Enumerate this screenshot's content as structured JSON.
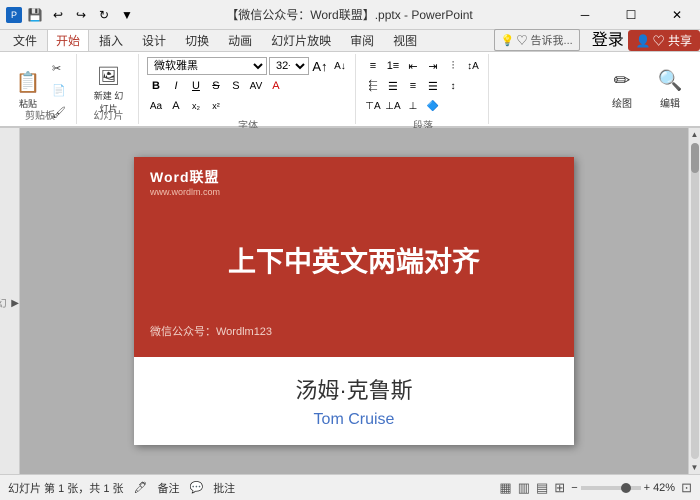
{
  "titlebar": {
    "title": "【微信公众号：Word联盟】.pptx - PowerPoint",
    "save_icon": "💾",
    "undo": "↩",
    "redo": "↪",
    "customize": "▼",
    "window_min": "─",
    "window_restore": "🗗",
    "window_close": "✕"
  },
  "ribbon": {
    "tabs": [
      "文件",
      "开始",
      "插入",
      "设计",
      "切换",
      "动画",
      "幻灯片放映",
      "审阅",
      "视图"
    ],
    "active_tab": "开始",
    "tell_me_label": "♡ 告诉我...",
    "login_label": "登录",
    "share_label": "♡ 共享"
  },
  "groups": {
    "clipboard_label": "剪贴板",
    "paste_label": "粘贴",
    "new_slide_label": "新建\n幻灯片",
    "slides_label": "幻灯片",
    "draw_label": "绘图",
    "edit_label": "编辑",
    "font_name": "微软雅黑",
    "font_size": "32+",
    "bold": "B",
    "italic": "I",
    "underline": "U",
    "strikethrough": "S",
    "font_color_up": "A",
    "font_color_down": "A"
  },
  "slide": {
    "logo_text": "Word联盟",
    "logo_url": "www.wordlm.com",
    "main_title": "上下中英文两端对齐",
    "wechat_text": "微信公众号：Wordlm123",
    "name_chinese": "汤姆·克鲁斯",
    "name_english": "Tom Cruise"
  },
  "status": {
    "slide_info": "幻灯片 第 1 张，共 1 张",
    "notes_placeholder": "备注",
    "comment_placeholder": "批注",
    "zoom_percent": "42%",
    "view_icons": [
      "▦",
      "▥",
      "▤",
      "⊞"
    ]
  },
  "colors": {
    "red_bg": "#b5372a",
    "accent_blue": "#4472c4",
    "ribbon_active": "#b5382a"
  }
}
